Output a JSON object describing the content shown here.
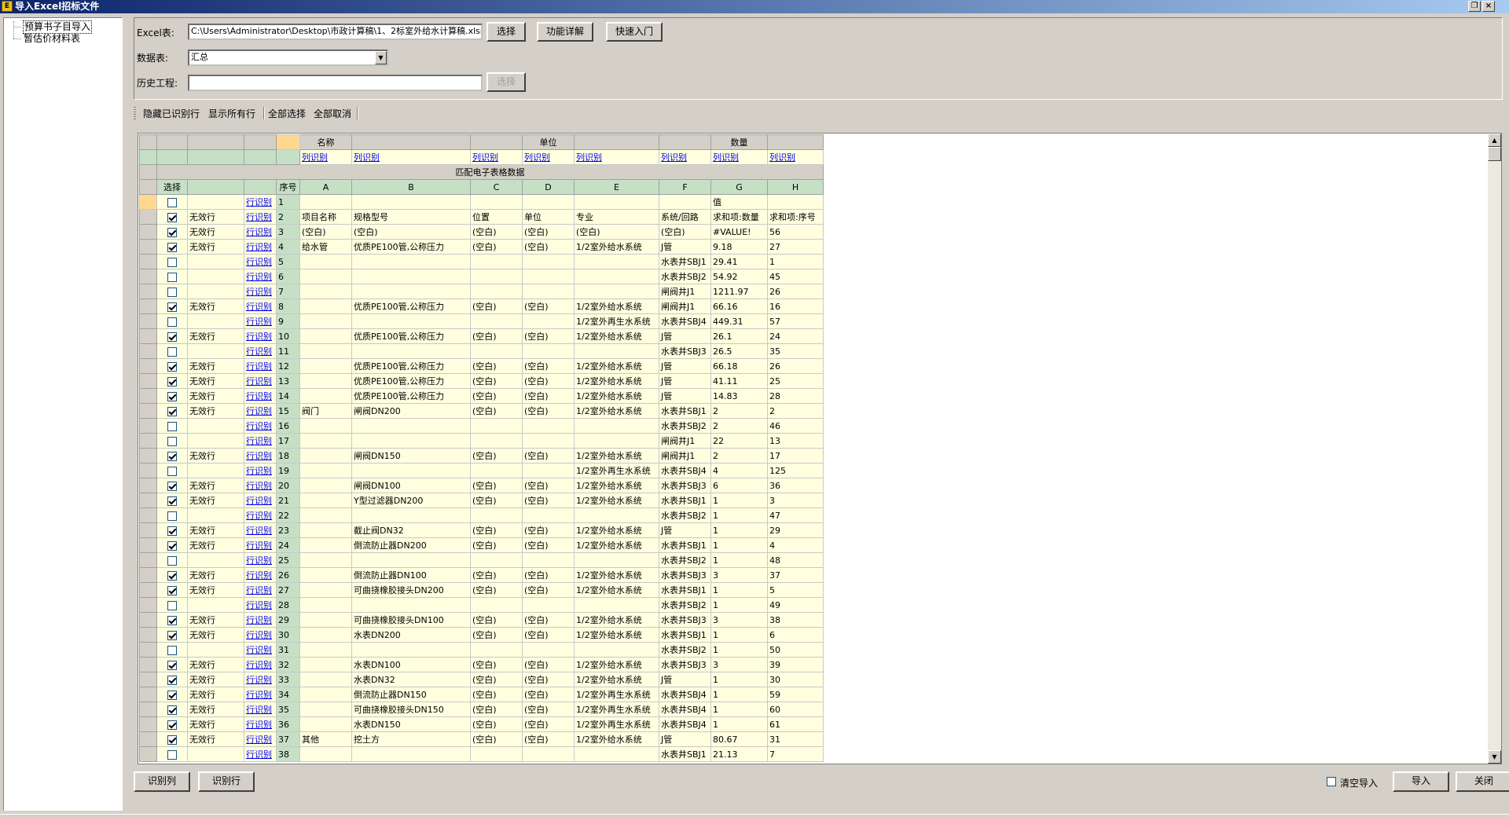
{
  "window": {
    "title": "导入Excel招标文件"
  },
  "tree": {
    "items": [
      {
        "label": "预算书子目导入"
      },
      {
        "label": "暂估价材料表"
      }
    ]
  },
  "form": {
    "excel_label": "Excel表:",
    "excel_path": "C:\\Users\\Administrator\\Desktop\\市政计算稿\\1、2标室外给水计算稿.xlsm",
    "select_button": "选择",
    "detail_button": "功能详解",
    "quickstart_button": "快速入门",
    "sheet_label": "数据表:",
    "sheet_value": "汇总",
    "history_label": "历史工程:",
    "history_value": "",
    "history_select_button": "选择"
  },
  "toolbar": {
    "hide_recognized": "隐藏已识别行",
    "show_all": "显示所有行",
    "select_all": "全部选择",
    "deselect_all": "全部取消"
  },
  "grid": {
    "group_headers": {
      "name": "名称",
      "unit": "单位",
      "quantity": "数量"
    },
    "col_recognize": "列识别",
    "match_title": "匹配电子表格数据",
    "select_header": "选择",
    "seq_header": "序号",
    "col_letters": [
      "A",
      "B",
      "C",
      "D",
      "E",
      "F",
      "G",
      "H"
    ],
    "row_recognize": "行识别",
    "rows": [
      {
        "n": "1",
        "chk": false,
        "st": "",
        "c": [
          "",
          "",
          "",
          "",
          "",
          "",
          "值",
          ""
        ]
      },
      {
        "n": "2",
        "chk": true,
        "st": "无效行",
        "c": [
          "项目名称",
          "规格型号",
          "位置",
          "单位",
          "专业",
          "系统/回路",
          "求和项:数量",
          "求和项:序号"
        ]
      },
      {
        "n": "3",
        "chk": true,
        "st": "无效行",
        "c": [
          "(空白)",
          "(空白)",
          "(空白)",
          "(空白)",
          "(空白)",
          "(空白)",
          "#VALUE!",
          "56"
        ]
      },
      {
        "n": "4",
        "chk": true,
        "st": "无效行",
        "c": [
          "给水管",
          "优质PE100管,公称压力",
          "(空白)",
          "(空白)",
          "1/2室外给水系统",
          "J管",
          "9.18",
          "27"
        ]
      },
      {
        "n": "5",
        "chk": false,
        "st": "",
        "c": [
          "",
          "",
          "",
          "",
          "",
          "水表井SBJ1",
          "29.41",
          "1"
        ]
      },
      {
        "n": "6",
        "chk": false,
        "st": "",
        "c": [
          "",
          "",
          "",
          "",
          "",
          "水表井SBJ2",
          "54.92",
          "45"
        ]
      },
      {
        "n": "7",
        "chk": false,
        "st": "",
        "c": [
          "",
          "",
          "",
          "",
          "",
          "闸阀井J1",
          "1211.97",
          "26"
        ]
      },
      {
        "n": "8",
        "chk": true,
        "st": "无效行",
        "c": [
          "",
          "优质PE100管,公称压力",
          "(空白)",
          "(空白)",
          "1/2室外给水系统",
          "闸阀井J1",
          "66.16",
          "16"
        ]
      },
      {
        "n": "9",
        "chk": false,
        "st": "",
        "c": [
          "",
          "",
          "",
          "",
          "1/2室外再生水系统",
          "水表井SBJ4",
          "449.31",
          "57"
        ]
      },
      {
        "n": "10",
        "chk": true,
        "st": "无效行",
        "c": [
          "",
          "优质PE100管,公称压力",
          "(空白)",
          "(空白)",
          "1/2室外给水系统",
          "J管",
          "26.1",
          "24"
        ]
      },
      {
        "n": "11",
        "chk": false,
        "st": "",
        "c": [
          "",
          "",
          "",
          "",
          "",
          "水表井SBJ3",
          "26.5",
          "35"
        ]
      },
      {
        "n": "12",
        "chk": true,
        "st": "无效行",
        "c": [
          "",
          "优质PE100管,公称压力",
          "(空白)",
          "(空白)",
          "1/2室外给水系统",
          "J管",
          "66.18",
          "26"
        ]
      },
      {
        "n": "13",
        "chk": true,
        "st": "无效行",
        "c": [
          "",
          "优质PE100管,公称压力",
          "(空白)",
          "(空白)",
          "1/2室外给水系统",
          "J管",
          "41.11",
          "25"
        ]
      },
      {
        "n": "14",
        "chk": true,
        "st": "无效行",
        "c": [
          "",
          "优质PE100管,公称压力",
          "(空白)",
          "(空白)",
          "1/2室外给水系统",
          "J管",
          "14.83",
          "28"
        ]
      },
      {
        "n": "15",
        "chk": true,
        "st": "无效行",
        "c": [
          "阀门",
          "闸阀DN200",
          "(空白)",
          "(空白)",
          "1/2室外给水系统",
          "水表井SBJ1",
          "2",
          "2"
        ]
      },
      {
        "n": "16",
        "chk": false,
        "st": "",
        "c": [
          "",
          "",
          "",
          "",
          "",
          "水表井SBJ2",
          "2",
          "46"
        ]
      },
      {
        "n": "17",
        "chk": false,
        "st": "",
        "c": [
          "",
          "",
          "",
          "",
          "",
          "闸阀井J1",
          "22",
          "13"
        ]
      },
      {
        "n": "18",
        "chk": true,
        "st": "无效行",
        "c": [
          "",
          "闸阀DN150",
          "(空白)",
          "(空白)",
          "1/2室外给水系统",
          "闸阀井J1",
          "2",
          "17"
        ]
      },
      {
        "n": "19",
        "chk": false,
        "st": "",
        "c": [
          "",
          "",
          "",
          "",
          "1/2室外再生水系统",
          "水表井SBJ4",
          "4",
          "125"
        ]
      },
      {
        "n": "20",
        "chk": true,
        "st": "无效行",
        "c": [
          "",
          "闸阀DN100",
          "(空白)",
          "(空白)",
          "1/2室外给水系统",
          "水表井SBJ3",
          "6",
          "36"
        ]
      },
      {
        "n": "21",
        "chk": true,
        "st": "无效行",
        "c": [
          "",
          "Y型过滤器DN200",
          "(空白)",
          "(空白)",
          "1/2室外给水系统",
          "水表井SBJ1",
          "1",
          "3"
        ]
      },
      {
        "n": "22",
        "chk": false,
        "st": "",
        "c": [
          "",
          "",
          "",
          "",
          "",
          "水表井SBJ2",
          "1",
          "47"
        ]
      },
      {
        "n": "23",
        "chk": true,
        "st": "无效行",
        "c": [
          "",
          "截止阀DN32",
          "(空白)",
          "(空白)",
          "1/2室外给水系统",
          "J管",
          "1",
          "29"
        ]
      },
      {
        "n": "24",
        "chk": true,
        "st": "无效行",
        "c": [
          "",
          "倒流防止器DN200",
          "(空白)",
          "(空白)",
          "1/2室外给水系统",
          "水表井SBJ1",
          "1",
          "4"
        ]
      },
      {
        "n": "25",
        "chk": false,
        "st": "",
        "c": [
          "",
          "",
          "",
          "",
          "",
          "水表井SBJ2",
          "1",
          "48"
        ]
      },
      {
        "n": "26",
        "chk": true,
        "st": "无效行",
        "c": [
          "",
          "倒流防止器DN100",
          "(空白)",
          "(空白)",
          "1/2室外给水系统",
          "水表井SBJ3",
          "3",
          "37"
        ]
      },
      {
        "n": "27",
        "chk": true,
        "st": "无效行",
        "c": [
          "",
          "可曲挠橡胶接头DN200",
          "(空白)",
          "(空白)",
          "1/2室外给水系统",
          "水表井SBJ1",
          "1",
          "5"
        ]
      },
      {
        "n": "28",
        "chk": false,
        "st": "",
        "c": [
          "",
          "",
          "",
          "",
          "",
          "水表井SBJ2",
          "1",
          "49"
        ]
      },
      {
        "n": "29",
        "chk": true,
        "st": "无效行",
        "c": [
          "",
          "可曲挠橡胶接头DN100",
          "(空白)",
          "(空白)",
          "1/2室外给水系统",
          "水表井SBJ3",
          "3",
          "38"
        ]
      },
      {
        "n": "30",
        "chk": true,
        "st": "无效行",
        "c": [
          "",
          "水表DN200",
          "(空白)",
          "(空白)",
          "1/2室外给水系统",
          "水表井SBJ1",
          "1",
          "6"
        ]
      },
      {
        "n": "31",
        "chk": false,
        "st": "",
        "c": [
          "",
          "",
          "",
          "",
          "",
          "水表井SBJ2",
          "1",
          "50"
        ]
      },
      {
        "n": "32",
        "chk": true,
        "st": "无效行",
        "c": [
          "",
          "水表DN100",
          "(空白)",
          "(空白)",
          "1/2室外给水系统",
          "水表井SBJ3",
          "3",
          "39"
        ]
      },
      {
        "n": "33",
        "chk": true,
        "st": "无效行",
        "c": [
          "",
          "水表DN32",
          "(空白)",
          "(空白)",
          "1/2室外给水系统",
          "J管",
          "1",
          "30"
        ]
      },
      {
        "n": "34",
        "chk": true,
        "st": "无效行",
        "c": [
          "",
          "倒流防止器DN150",
          "(空白)",
          "(空白)",
          "1/2室外再生水系统",
          "水表井SBJ4",
          "1",
          "59"
        ]
      },
      {
        "n": "35",
        "chk": true,
        "st": "无效行",
        "c": [
          "",
          "可曲挠橡胶接头DN150",
          "(空白)",
          "(空白)",
          "1/2室外再生水系统",
          "水表井SBJ4",
          "1",
          "60"
        ]
      },
      {
        "n": "36",
        "chk": true,
        "st": "无效行",
        "c": [
          "",
          "水表DN150",
          "(空白)",
          "(空白)",
          "1/2室外再生水系统",
          "水表井SBJ4",
          "1",
          "61"
        ]
      },
      {
        "n": "37",
        "chk": true,
        "st": "无效行",
        "c": [
          "其他",
          "挖土方",
          "(空白)",
          "(空白)",
          "1/2室外给水系统",
          "J管",
          "80.67",
          "31"
        ]
      },
      {
        "n": "38",
        "chk": false,
        "st": "",
        "c": [
          "",
          "",
          "",
          "",
          "",
          "水表井SBJ1",
          "21.13",
          "7"
        ]
      }
    ]
  },
  "bottom": {
    "recognize_col": "识别列",
    "recognize_row": "识别行",
    "clear_import": "清空导入",
    "import": "导入",
    "close": "关闭"
  }
}
